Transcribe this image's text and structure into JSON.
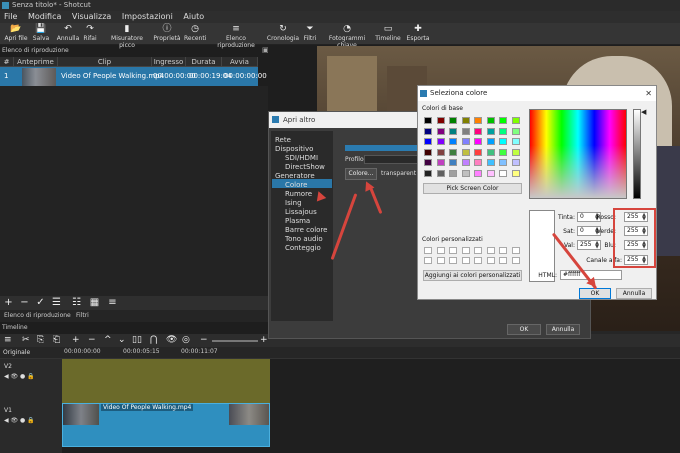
{
  "window": {
    "title": "Senza titolo* - Shotcut"
  },
  "menu": [
    "File",
    "Modifica",
    "Visualizza",
    "Impostazioni",
    "Aiuto"
  ],
  "toolbar": [
    {
      "icon": "folder-open-icon",
      "glyph": "📂",
      "label": "Apri file"
    },
    {
      "icon": "save-icon",
      "glyph": "💾",
      "label": "Salva"
    },
    {
      "icon": "undo-icon",
      "glyph": "↶",
      "label": "Annulla"
    },
    {
      "icon": "redo-icon",
      "glyph": "↷",
      "label": "Rifai"
    },
    {
      "icon": "peak-meter-icon",
      "glyph": "▮",
      "label": "Misuratore picco"
    },
    {
      "icon": "properties-icon",
      "glyph": "ⓘ",
      "label": "Proprietà"
    },
    {
      "icon": "recent-icon",
      "glyph": "◷",
      "label": "Recenti"
    },
    {
      "icon": "playlist-icon",
      "glyph": "≡",
      "label": "Elenco riproduzione"
    },
    {
      "icon": "history-icon",
      "glyph": "↻",
      "label": "Cronologia"
    },
    {
      "icon": "filter-icon",
      "glyph": "⏷",
      "label": "Filtri"
    },
    {
      "icon": "keyframes-icon",
      "glyph": "◔",
      "label": "Fotogrammi chiave"
    },
    {
      "icon": "timeline-icon",
      "glyph": "▭",
      "label": "Timeline"
    },
    {
      "icon": "export-icon",
      "glyph": "✚",
      "label": "Esporta"
    }
  ],
  "playlist": {
    "title": "Elenco di riproduzione",
    "columns": [
      "#",
      "Anteprime",
      "Clip",
      "Ingresso",
      "Durata",
      "Avvia"
    ],
    "rows": [
      {
        "num": "1",
        "clip": "Video Of People Walking.mp4",
        "in": "00:00:00:00",
        "duration": "00:00:19:04",
        "start": "00:00:00:00"
      }
    ],
    "tabs": [
      "Elenco di riproduzione",
      "Filtri"
    ]
  },
  "timeline": {
    "label": "Timeline",
    "track_origin": "Originale",
    "ruler": [
      "00:00:00:00",
      "00:00:05:15",
      "00:00:11:07"
    ],
    "tracks": [
      {
        "name": "V2"
      },
      {
        "name": "V1",
        "clip": "Video Of People Walking.mp4"
      }
    ]
  },
  "apri_altro": {
    "title": "Apri altro",
    "items": [
      {
        "label": "Rete",
        "indent": 0
      },
      {
        "label": "Dispositivo",
        "indent": 0
      },
      {
        "label": "SDI/HDMI",
        "indent": 1
      },
      {
        "label": "DirectShow",
        "indent": 1
      },
      {
        "label": "Generatore",
        "indent": 0
      },
      {
        "label": "Colore",
        "indent": 1,
        "selected": true
      },
      {
        "label": "Rumore",
        "indent": 1
      },
      {
        "label": "Ising",
        "indent": 1
      },
      {
        "label": "Lissajous",
        "indent": 1
      },
      {
        "label": "Plasma",
        "indent": 1
      },
      {
        "label": "Barre colore",
        "indent": 1
      },
      {
        "label": "Tono audio",
        "indent": 1
      },
      {
        "label": "Conteggio",
        "indent": 1
      }
    ],
    "profile_label": "Profilo",
    "color_button": "Colore...",
    "transparent": "transparent",
    "ok": "OK",
    "cancel": "Annulla"
  },
  "color_picker": {
    "title": "Seleziona colore",
    "basic_label": "Colori di base",
    "pick_screen": "Pick Screen Color",
    "custom_label": "Colori personalizzati",
    "add_custom": "Aggiungi ai colori personalizzati",
    "fields": [
      {
        "label": "Tinta:",
        "value": "0"
      },
      {
        "label": "Sat:",
        "value": "0"
      },
      {
        "label": "Val:",
        "value": "255"
      },
      {
        "label": "Rosso:",
        "value": "255"
      },
      {
        "label": "Verde:",
        "value": "255"
      },
      {
        "label": "Blu:",
        "value": "255"
      },
      {
        "label": "Canale alfa:",
        "value": "255"
      }
    ],
    "html_label": "HTML:",
    "html_value": "#ffffff",
    "ok": "OK",
    "cancel": "Annulla",
    "basic_colors": [
      "#000000",
      "#800000",
      "#008000",
      "#808000",
      "#ff8000",
      "#00c000",
      "#00ff00",
      "#80ff00",
      "#000080",
      "#800080",
      "#008080",
      "#808080",
      "#ff0080",
      "#00a0a0",
      "#00ff80",
      "#80ff80",
      "#0000ff",
      "#8000ff",
      "#0080ff",
      "#8080ff",
      "#ff00ff",
      "#00a0ff",
      "#00ffff",
      "#80ffff",
      "#400000",
      "#804040",
      "#408040",
      "#c0c040",
      "#ff4040",
      "#40c080",
      "#40ff40",
      "#c0ff40",
      "#400040",
      "#c040c0",
      "#4080c0",
      "#c080ff",
      "#ff80c0",
      "#40c0ff",
      "#80c0ff",
      "#c0c0ff",
      "#202020",
      "#606060",
      "#a0a0a0",
      "#c0c0c0",
      "#ff80ff",
      "#ffc0ff",
      "#ffffff",
      "#ffff80"
    ]
  }
}
